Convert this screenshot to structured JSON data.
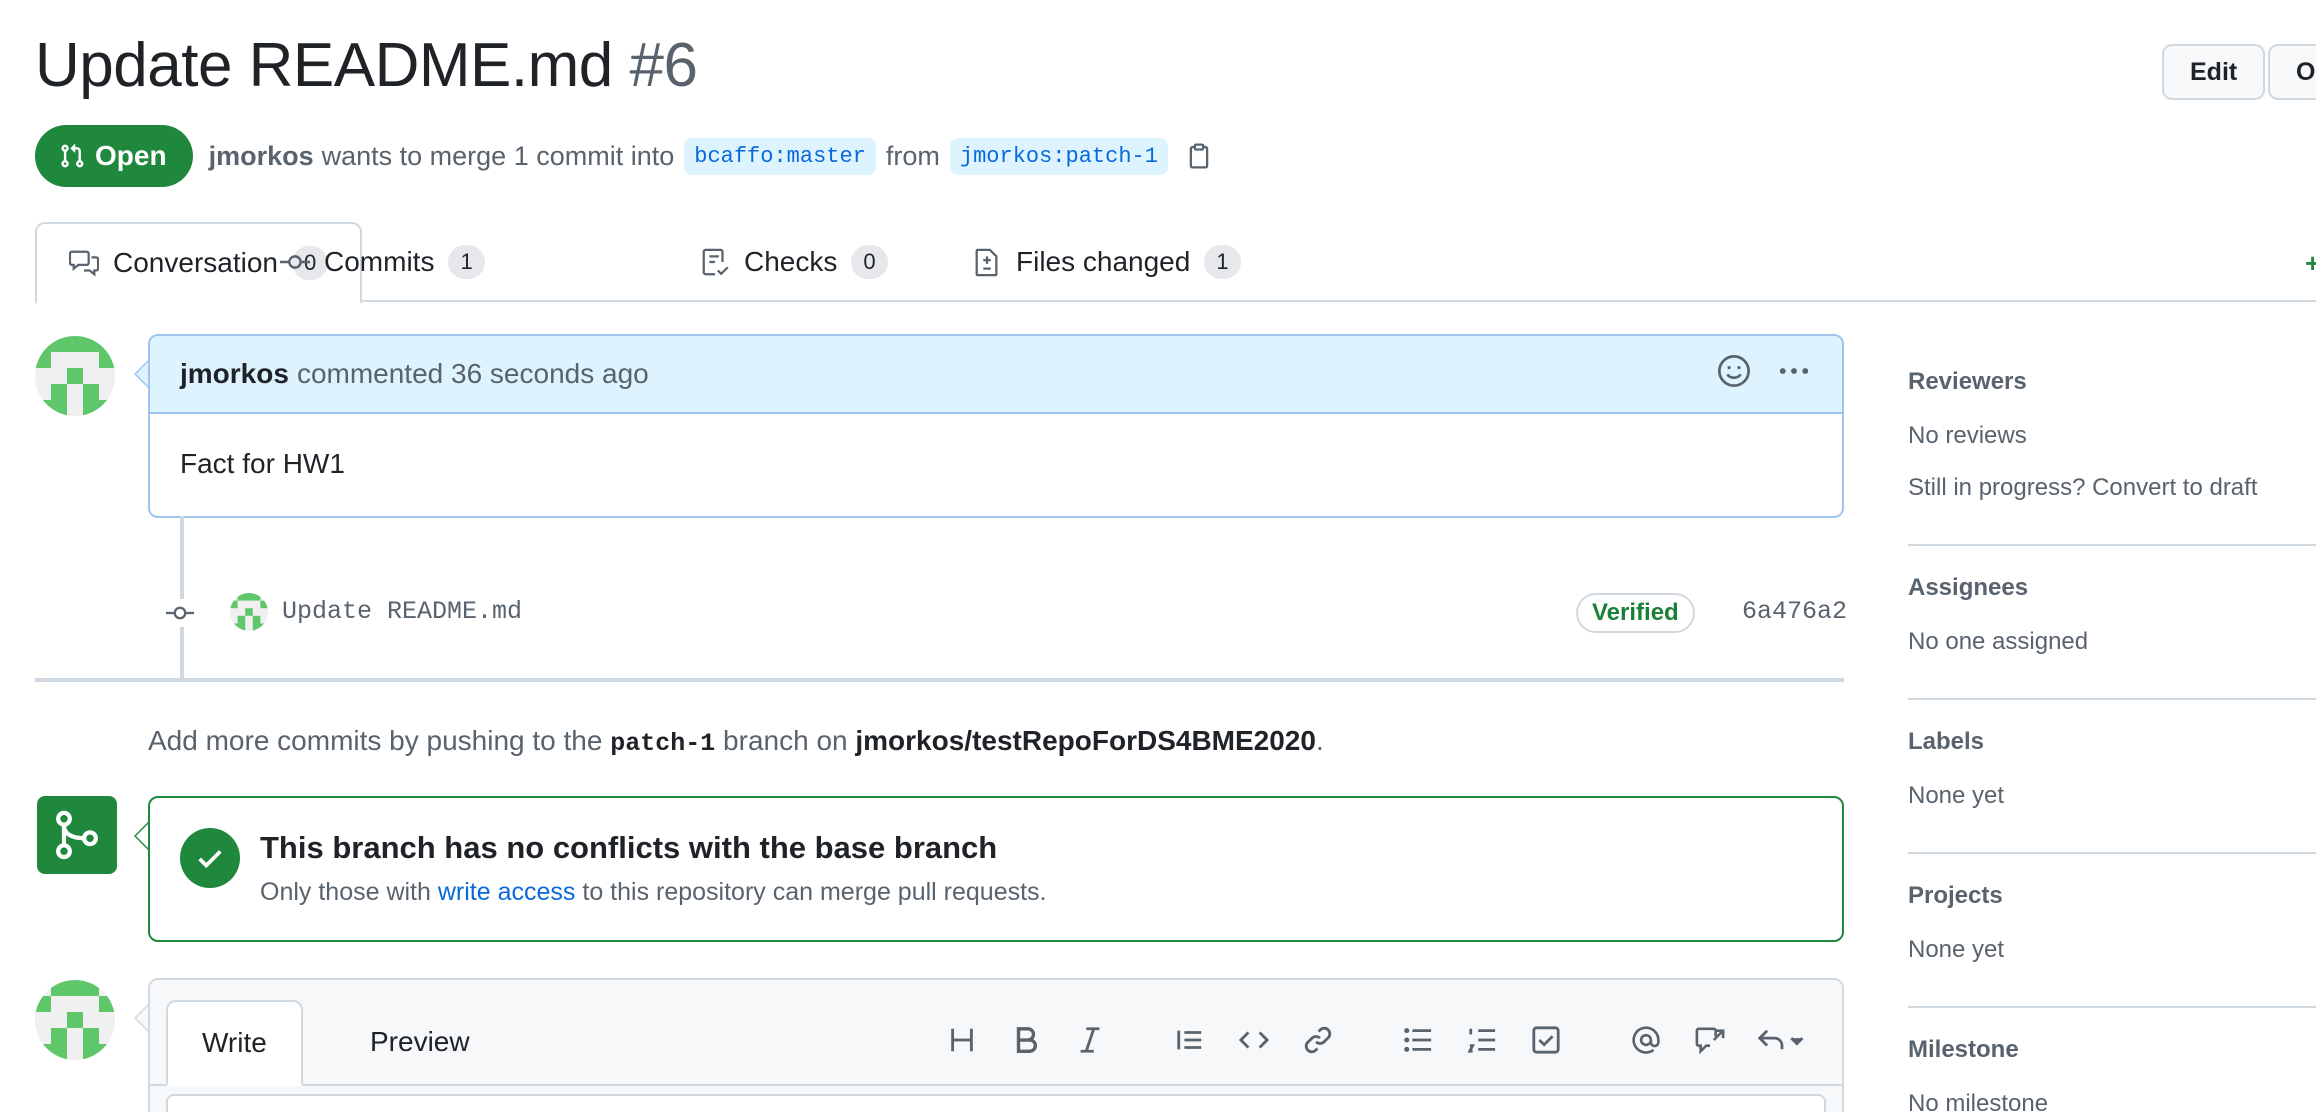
{
  "header": {
    "title": "Update README.md",
    "number": "#6",
    "edit_label": "Edit",
    "open_label": "Op"
  },
  "meta": {
    "state": "Open",
    "author": "jmorkos",
    "text_merge": "wants to merge 1 commit into",
    "base_branch": "bcaffo:master",
    "text_from": "from",
    "head_branch": "jmorkos:patch-1"
  },
  "tabs": [
    {
      "label": "Conversation",
      "count": "0",
      "icon": "comment-discussion-icon"
    },
    {
      "label": "Commits",
      "count": "1",
      "icon": "git-commit-icon"
    },
    {
      "label": "Checks",
      "count": "0",
      "icon": "checklist-icon"
    },
    {
      "label": "Files changed",
      "count": "1",
      "icon": "file-diff-icon"
    }
  ],
  "tabs_extra": "+",
  "comment": {
    "author": "jmorkos",
    "action": "commented 36 seconds ago",
    "body": "Fact for HW1"
  },
  "commit": {
    "message": "Update README.md",
    "badge": "Verified",
    "sha": "6a476a2"
  },
  "hint": {
    "prefix": "Add more commits by pushing to the",
    "branch": "patch-1",
    "middle": "branch on",
    "repo": "jmorkos/testRepoForDS4BME2020",
    "suffix": "."
  },
  "merge": {
    "title": "This branch has no conflicts with the base branch",
    "sub_prefix": "Only those with",
    "sub_link": "write access",
    "sub_suffix": "to this repository can merge pull requests."
  },
  "editor": {
    "write_tab": "Write",
    "preview_tab": "Preview",
    "tools": [
      "heading-icon",
      "bold-icon",
      "italic-icon",
      "quote-icon",
      "code-icon",
      "link-icon",
      "unordered-list-icon",
      "ordered-list-icon",
      "tasklist-icon",
      "mention-icon",
      "cross-reference-icon",
      "reply-icon"
    ]
  },
  "sidebar": {
    "reviewers": {
      "label": "Reviewers",
      "value": "No reviews",
      "link": "Still in progress? Convert to draft"
    },
    "assignees": {
      "label": "Assignees",
      "value": "No one assigned"
    },
    "labels": {
      "label": "Labels",
      "value": "None yet"
    },
    "projects": {
      "label": "Projects",
      "value": "None yet"
    },
    "milestone": {
      "label": "Milestone",
      "value": "No milestone"
    }
  },
  "colors": {
    "open_green": "#1f883d",
    "link_blue": "#0969da",
    "comment_header": "#ddf4ff",
    "border": "#d1d9e0"
  }
}
